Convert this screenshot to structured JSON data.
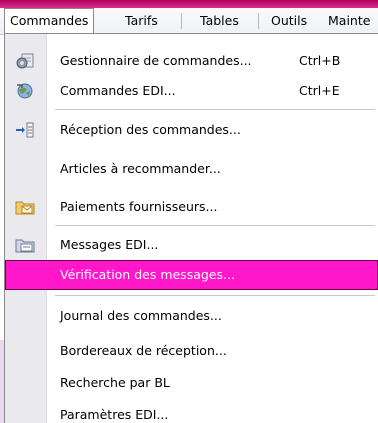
{
  "menubar": {
    "items": [
      {
        "label": "Commandes",
        "active": true
      },
      {
        "label": "Tarifs"
      },
      {
        "label": "Tables"
      },
      {
        "label": "Outils"
      },
      {
        "label": "Mainte"
      }
    ]
  },
  "colors": {
    "highlight": "#ff17c9",
    "brand_strip": "#c0106f"
  },
  "dropdown": {
    "items": [
      {
        "label": "Gestionnaire de commandes...",
        "shortcut": "Ctrl+B",
        "icon": "gear-document-icon"
      },
      {
        "label": "Commandes EDI...",
        "shortcut": "Ctrl+E",
        "icon": "edi-globe-icon"
      },
      {
        "label": "Réception des commandes...",
        "icon": "arrow-list-icon"
      },
      {
        "label": "Articles à recommander..."
      },
      {
        "label": "Paiements fournisseurs...",
        "icon": "folder-envelope-icon"
      },
      {
        "label": "Messages EDI...",
        "icon": "folder-message-icon"
      },
      {
        "label": "Vérification des messages...",
        "highlighted": true
      },
      {
        "label": "Journal des commandes..."
      },
      {
        "label": "Bordereaux de réception..."
      },
      {
        "label": "Recherche par BL"
      },
      {
        "label": "Paramètres EDI..."
      }
    ]
  }
}
